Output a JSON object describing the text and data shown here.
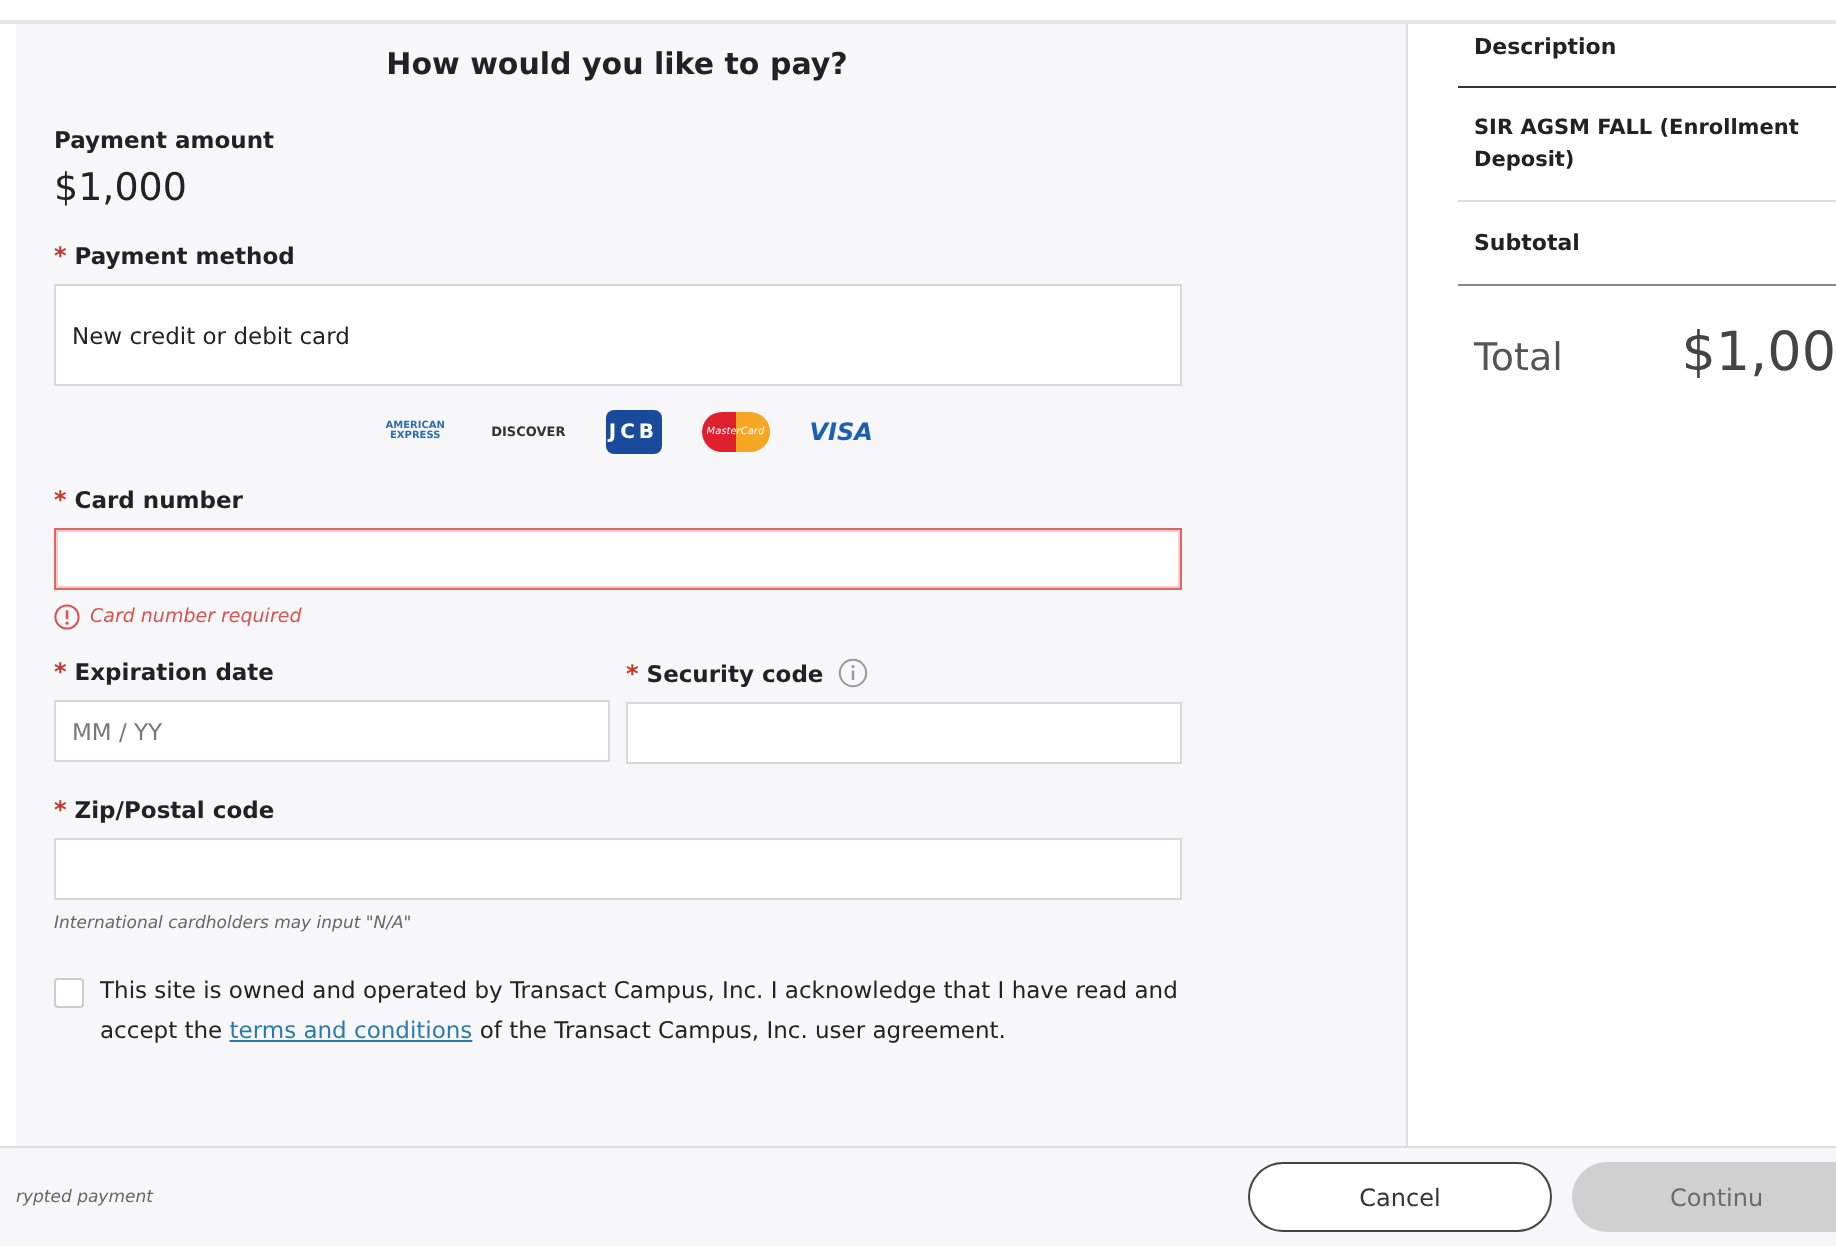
{
  "heading": "How would you like to pay?",
  "payment_amount": {
    "label": "Payment amount",
    "value": "$1,000"
  },
  "payment_method": {
    "marker": "*",
    "label": "Payment method",
    "value": "New credit or debit card"
  },
  "card_logos": [
    {
      "kind": "amex",
      "text": "AMERICAN EXPRESS"
    },
    {
      "kind": "discover",
      "text": "DISCOVER"
    },
    {
      "kind": "jcb",
      "text": "JCB"
    },
    {
      "kind": "mastercard",
      "text": "MasterCard"
    },
    {
      "kind": "visa",
      "text": "VISA"
    }
  ],
  "card_number": {
    "marker": "*",
    "label": "Card number",
    "invalid": true,
    "error": "Card number required"
  },
  "expiration": {
    "marker": "*",
    "label": "Expiration date",
    "placeholder": "MM / YY"
  },
  "security_code": {
    "marker": "*",
    "label": "Security code"
  },
  "zip": {
    "marker": "*",
    "label": "Zip/Postal code",
    "hint": "International cardholders may input \"N/A\""
  },
  "agreement": {
    "checked": false,
    "text_before": "This site is owned and operated by Transact Campus, Inc. I acknowledge that I have read and accept the ",
    "link": "terms and conditions",
    "text_after": " of the Transact Campus, Inc. user agreement."
  },
  "summary": {
    "header": "Description",
    "items": [
      "SIR AGSM FALL (Enrollment Deposit)"
    ],
    "subtotal_label": "Subtotal",
    "total_label": "Total",
    "total_value": "$1,00"
  },
  "footer": {
    "note": "rypted payment",
    "buttons": [
      {
        "label": "Cancel",
        "disabled": false
      },
      {
        "label": "Continu",
        "disabled": true
      }
    ]
  }
}
